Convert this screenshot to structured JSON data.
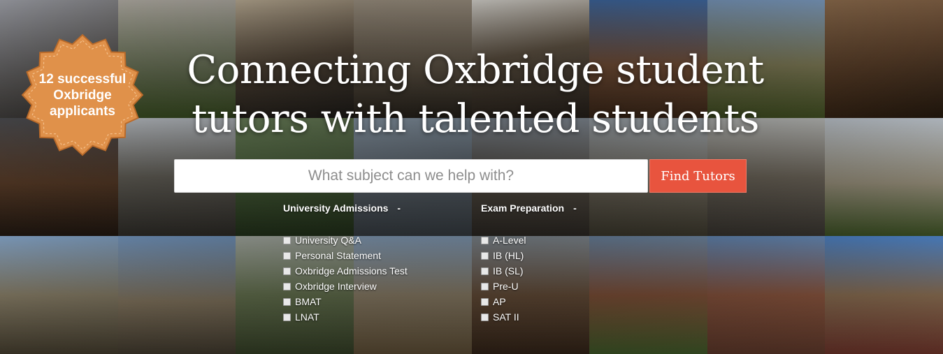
{
  "badge": {
    "text": "12 successful Oxbridge applicants",
    "color": "#e0914a"
  },
  "hero": {
    "title": "Connecting Oxbridge student tutors with talented students"
  },
  "search": {
    "placeholder": "What subject can we help with?",
    "value": ""
  },
  "find_button": {
    "label": "Find Tutors",
    "color": "#e8543e"
  },
  "filters": {
    "university": {
      "heading": "University Admissions",
      "toggle": "-",
      "items": [
        "University Q&A",
        "Personal Statement",
        "Oxbridge Admissions Test",
        "Oxbridge Interview",
        "BMAT",
        "LNAT"
      ]
    },
    "exam": {
      "heading": "Exam Preparation",
      "toggle": "-",
      "items": [
        "A-Level",
        "IB (HL)",
        "IB (SL)",
        "Pre-U",
        "AP",
        "SAT II"
      ]
    }
  }
}
